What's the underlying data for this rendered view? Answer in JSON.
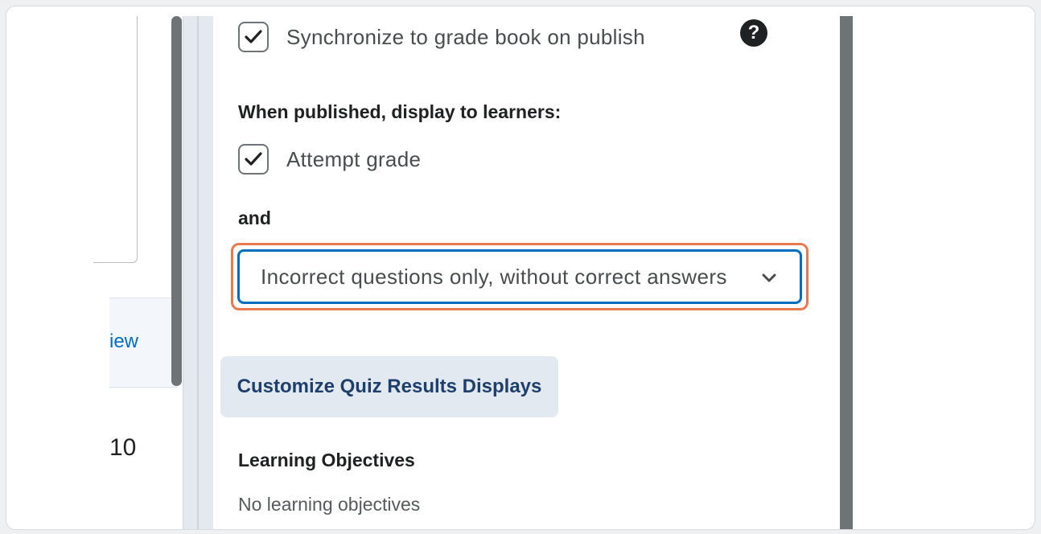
{
  "left_pane": {
    "link_fragment": "iew",
    "number_fragment": "10"
  },
  "panel": {
    "sync_checkbox_label": "Synchronize to grade book on publish",
    "sync_checked": true,
    "display_heading": "When published, display to learners:",
    "attempt_grade_label": "Attempt grade",
    "attempt_grade_checked": true,
    "and_label": "and",
    "results_select_value": "Incorrect questions only, without correct answers",
    "customize_button_label": "Customize Quiz Results Displays",
    "objectives_heading": "Learning Objectives",
    "objectives_empty": "No learning objectives"
  },
  "colors": {
    "focus_ring": "#e87a50",
    "select_border": "#006fbf",
    "button_bg": "#e3e9f1",
    "button_text": "#1e3f6b",
    "link": "#006fbf"
  },
  "icons": {
    "help": "question-circle-icon",
    "check": "checkmark-icon",
    "chevron": "chevron-down-icon"
  }
}
